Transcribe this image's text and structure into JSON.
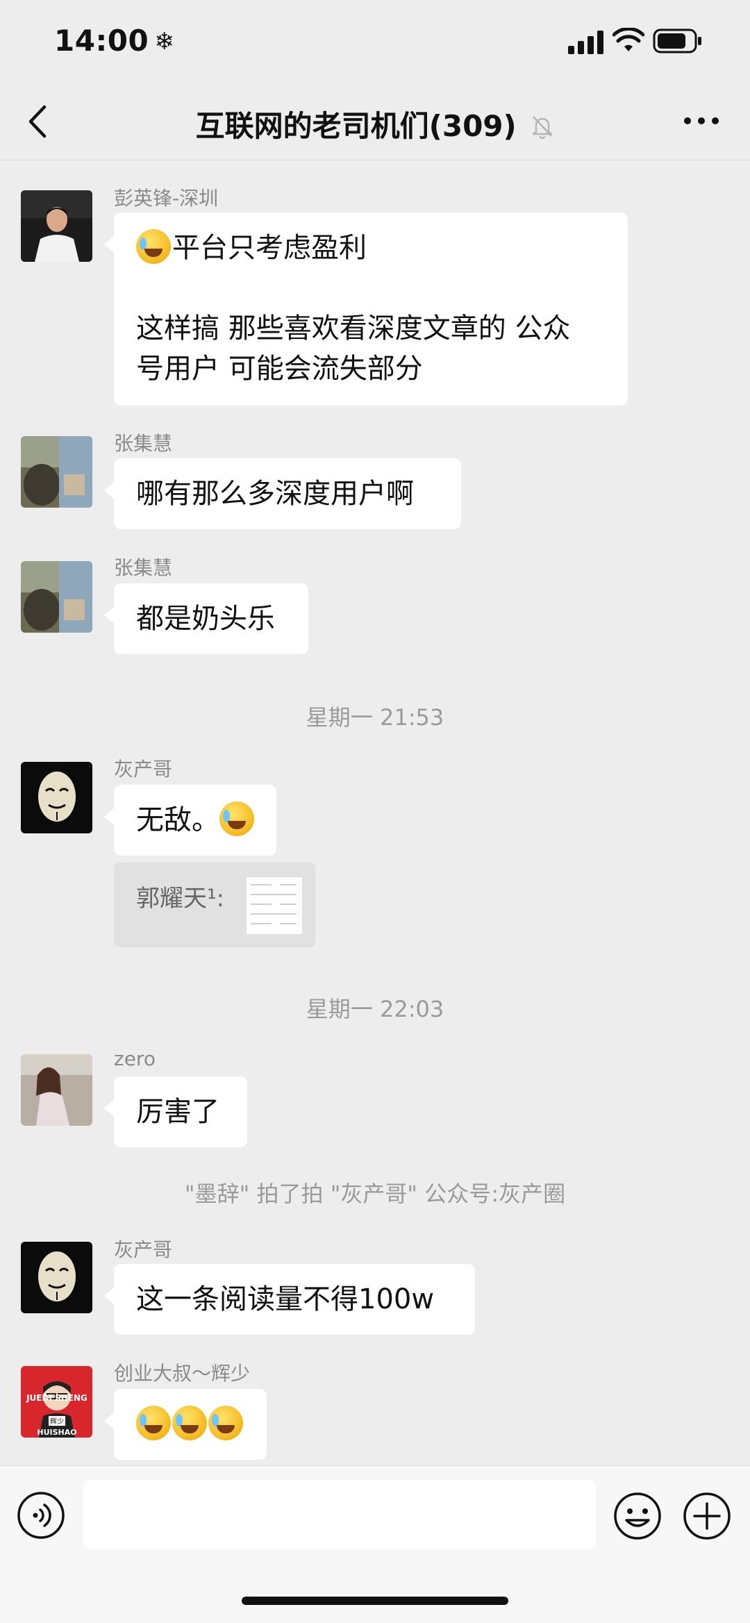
{
  "status_bar": {
    "time": "14:00"
  },
  "header": {
    "title": "互联网的老司机们(309)"
  },
  "messages": [
    {
      "sender": "彭英锋-深圳",
      "lines": [
        "平台只考虑盈利",
        "",
        "这样搞 那些喜欢看深度文章的 公众",
        "号用户 可能会流失部分"
      ]
    },
    {
      "sender": "张集慧",
      "text": "哪有那么多深度用户啊"
    },
    {
      "sender": "张集慧",
      "text": "都是奶头乐"
    },
    {
      "timestamp": "星期一 21:53"
    },
    {
      "sender": "灰产哥",
      "text": "无敌。",
      "quote": {
        "text": "郭耀天¹:"
      }
    },
    {
      "timestamp": "星期一 22:03"
    },
    {
      "sender": "zero",
      "text": "厉害了"
    },
    {
      "system": "\"墨辞\" 拍了拍 \"灰产哥\" 公众号:灰产圈"
    },
    {
      "sender": "灰产哥",
      "text": "这一条阅读量不得100w"
    },
    {
      "sender": "创业大叔～辉少",
      "text": ""
    }
  ],
  "avatar_labels": {
    "top": "JUEDI SHENG",
    "bottom": "HUISHAO",
    "badge": "辉少"
  },
  "input": {
    "placeholder": ""
  },
  "icons": [
    "chevron-left-icon",
    "mute-bell-icon",
    "more-icon",
    "voice-icon",
    "emoji-icon",
    "plus-icon",
    "cry-laugh-emoji"
  ],
  "colors": {
    "background": "#ededed",
    "bubble": "#ffffff",
    "text": "#111111",
    "meta": "#9a9a9a"
  }
}
